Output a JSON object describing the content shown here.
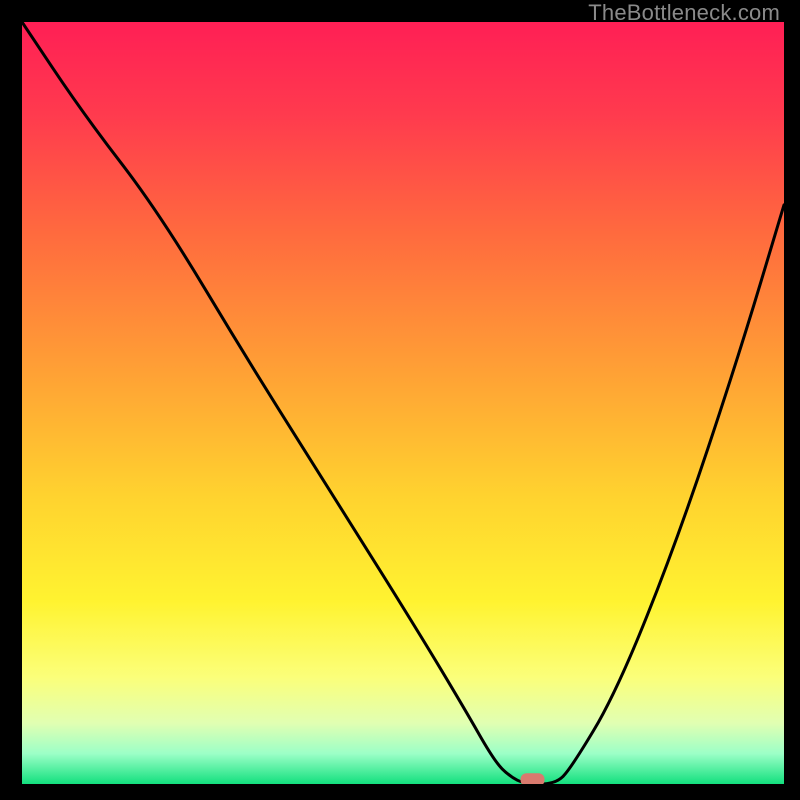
{
  "watermark": "TheBottleneck.com",
  "chart_data": {
    "type": "line",
    "title": "",
    "xlabel": "",
    "ylabel": "",
    "xlim": [
      0,
      100
    ],
    "ylim": [
      0,
      100
    ],
    "background": {
      "type": "vertical-gradient",
      "stops": [
        {
          "offset": 0.0,
          "color": "#ff1f55"
        },
        {
          "offset": 0.12,
          "color": "#ff3a4e"
        },
        {
          "offset": 0.28,
          "color": "#ff6b3e"
        },
        {
          "offset": 0.46,
          "color": "#ffa135"
        },
        {
          "offset": 0.62,
          "color": "#ffd22f"
        },
        {
          "offset": 0.76,
          "color": "#fff330"
        },
        {
          "offset": 0.86,
          "color": "#fbff7a"
        },
        {
          "offset": 0.92,
          "color": "#e1ffb2"
        },
        {
          "offset": 0.96,
          "color": "#9cffc7"
        },
        {
          "offset": 1.0,
          "color": "#13e07e"
        }
      ]
    },
    "series": [
      {
        "name": "bottleneck-curve",
        "color": "#000000",
        "x": [
          0,
          8,
          18,
          30,
          42,
          52,
          58,
          62,
          64,
          66,
          70,
          72,
          78,
          86,
          94,
          100
        ],
        "y": [
          100,
          88,
          75,
          55,
          36,
          20,
          10,
          3,
          1,
          0,
          0,
          2,
          12,
          32,
          56,
          76
        ]
      }
    ],
    "marker": {
      "name": "optimal-point",
      "x": 67,
      "y": 0.5,
      "color": "#d97a6e"
    }
  }
}
